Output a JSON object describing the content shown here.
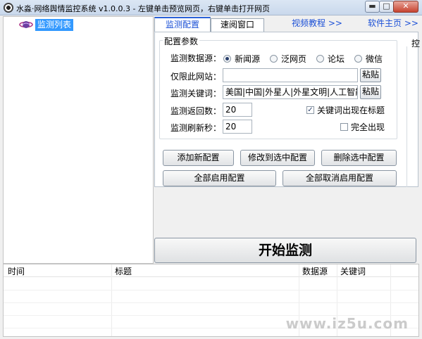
{
  "window": {
    "title": "水淼·网络舆情监控系统 v1.0.0.3 - 左键单击预览网页，右键单击打开网页",
    "min_label": "▬",
    "max_label": "□",
    "close_label": "✕"
  },
  "sidebar": {
    "items": [
      {
        "label": "监测列表",
        "icon": "earth-ring-icon"
      }
    ]
  },
  "tabs": {
    "active": "监测配置",
    "second": "速阅窗口",
    "link1": "视频教程 >>",
    "link2": "软件主页 >>"
  },
  "config": {
    "legend": "配置参数",
    "side_cut_label": "控",
    "source_label": "监测数据源：",
    "sources": [
      {
        "label": "新闻源",
        "checked": true
      },
      {
        "label": "泛网页",
        "checked": false
      },
      {
        "label": "论坛",
        "checked": false
      },
      {
        "label": "微信",
        "checked": false
      }
    ],
    "site_label": "仅限此网站：",
    "site_value": "",
    "paste_label": "粘贴",
    "keyword_label": "监测关键词：",
    "keyword_value": "美国|中国|外星人|外星文明|人工智能",
    "return_label": "监测返回数：",
    "return_value": "20",
    "refresh_label": "监测刷新秒：",
    "refresh_value": "20",
    "title_check_label": "关键词出现在标题",
    "title_check": true,
    "full_check_label": "完全出现",
    "full_check": false
  },
  "buttons": {
    "add": "添加新配置",
    "modify": "修改到选中配置",
    "delete": "删除选中配置",
    "enable_all": "全部启用配置",
    "disable_all": "全部取消启用配置",
    "start": "开始监测"
  },
  "results": {
    "columns": [
      "时间",
      "标题",
      "数据源",
      "关键词"
    ],
    "rows": []
  },
  "watermark": "www.iz5u.com"
}
